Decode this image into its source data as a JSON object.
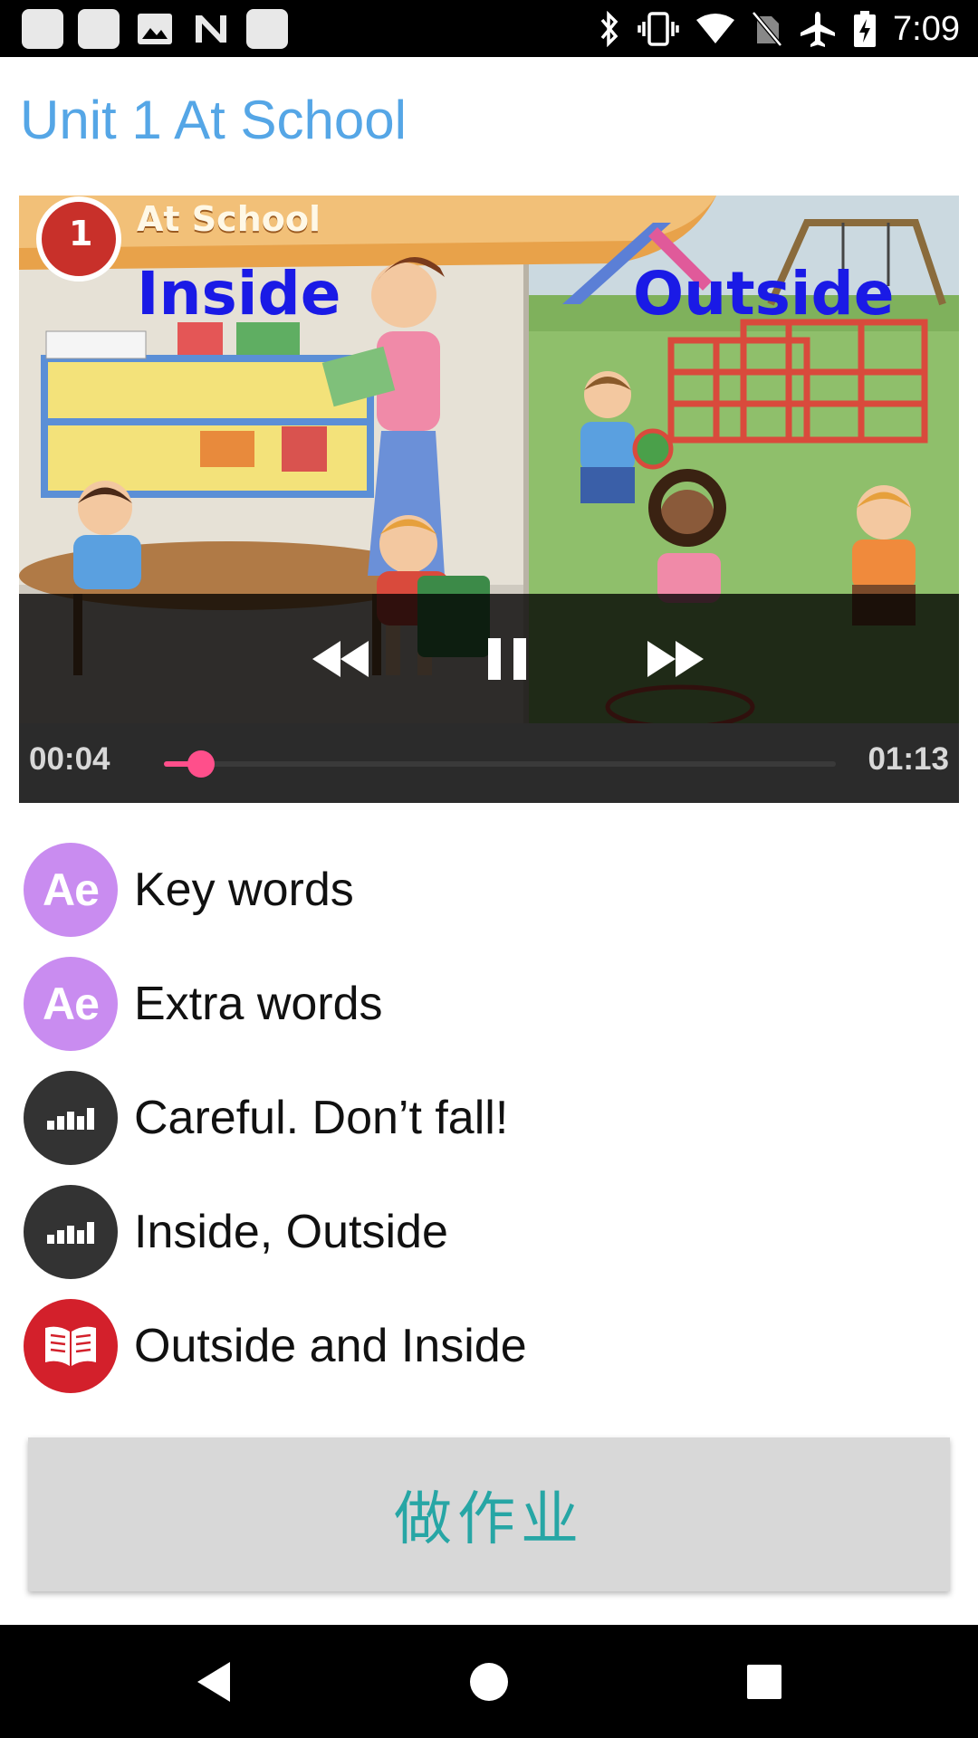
{
  "status_bar": {
    "time": "7:09",
    "left_icons": [
      "notification-square-icon",
      "notification-square-icon",
      "image-icon",
      "n-logo-icon",
      "notification-square-icon"
    ],
    "right_icons": [
      "bluetooth-icon",
      "vibrate-icon",
      "wifi-icon",
      "no-sim-icon",
      "airplane-mode-icon",
      "battery-charging-icon"
    ]
  },
  "page": {
    "title": "Unit 1 At School"
  },
  "video": {
    "scene_badge_number": "1",
    "scene_badge_title": "At School",
    "scene_label_left": "Inside",
    "scene_label_right": "Outside",
    "current_time": "00:04",
    "duration": "01:13",
    "progress_fraction": 0.055,
    "controls": [
      "rewind-icon",
      "pause-icon",
      "fast-forward-icon"
    ],
    "accent_color": "#ff4f8b"
  },
  "items": [
    {
      "label": "Key words",
      "icon": "ae-icon",
      "icon_text": "Ae"
    },
    {
      "label": "Extra words",
      "icon": "ae-icon",
      "icon_text": "Ae"
    },
    {
      "label": "Careful. Don’t fall!",
      "icon": "audio-bars-icon"
    },
    {
      "label": "Inside, Outside",
      "icon": "audio-bars-icon"
    },
    {
      "label": "Outside and Inside",
      "icon": "open-book-icon"
    }
  ],
  "homework_button": {
    "label": "做作业"
  },
  "colors": {
    "title": "#55a6e6",
    "homework_text": "#27a6a5",
    "ae_icon": "#c98cf0",
    "book_icon": "#d3202b"
  }
}
